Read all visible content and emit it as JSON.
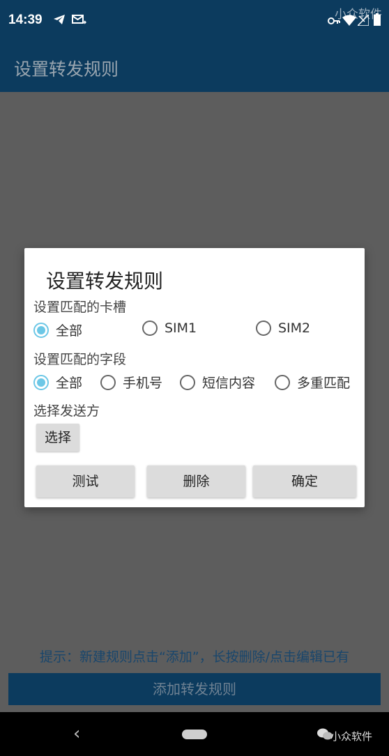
{
  "status_bar": {
    "time": "14:39",
    "watermark": "小众软件",
    "icons": [
      "telegram-icon",
      "mail-icon",
      "vpn-key-icon",
      "wifi-icon",
      "signal-icon",
      "battery-icon"
    ]
  },
  "app_bar": {
    "title": "设置转发规则"
  },
  "dialog": {
    "title": "设置转发规则",
    "sim_section": {
      "label": "设置匹配的卡槽",
      "options": [
        "全部",
        "SIM1",
        "SIM2"
      ],
      "selected": "全部"
    },
    "field_section": {
      "label": "设置匹配的字段",
      "options": [
        "全部",
        "手机号",
        "短信内容",
        "多重匹配"
      ],
      "selected": "全部"
    },
    "sender_section": {
      "label": "选择发送方",
      "button": "选择"
    },
    "actions": {
      "test": "测试",
      "delete": "删除",
      "confirm": "确定"
    }
  },
  "hint": "提示：新建规则点击“添加”，长按删除/点击编辑已有",
  "add_button": "添加转发规则",
  "nav": {
    "back": "‹",
    "watermark": "小众软件"
  },
  "colors": {
    "primary": "#0c3b5e",
    "radio_checked": "#6cc7e6",
    "scrim": "#5d5d5d"
  }
}
